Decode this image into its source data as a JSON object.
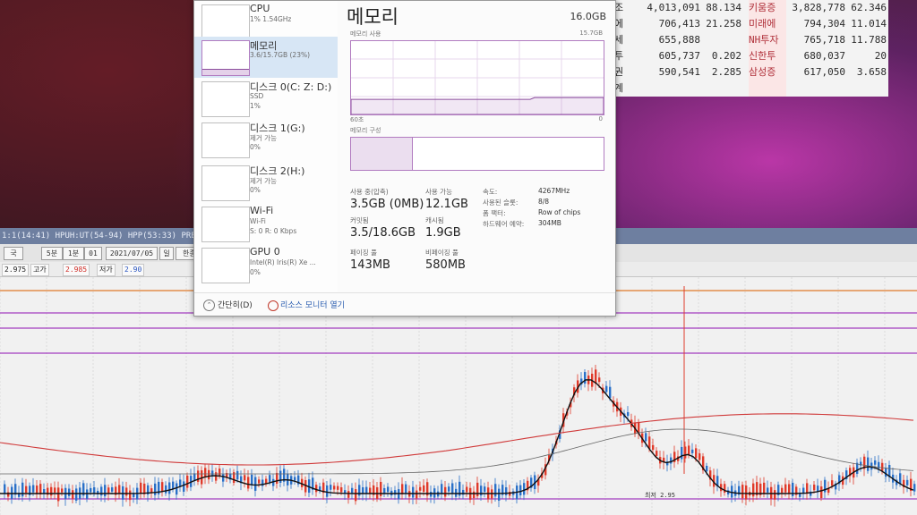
{
  "taskmgr": {
    "sidebar": [
      {
        "title": "CPU",
        "sub": "1% 1.54GHz"
      },
      {
        "title": "메모리",
        "sub": "3.6/15.7GB (23%)"
      },
      {
        "title": "디스크 0(C: Z: D:)",
        "sub": "SSD",
        "sub2": "1%"
      },
      {
        "title": "디스크 1(G:)",
        "sub": "제거 가능",
        "sub2": "0%"
      },
      {
        "title": "디스크 2(H:)",
        "sub": "제거 가능",
        "sub2": "0%"
      },
      {
        "title": "Wi-Fi",
        "sub": "Wi-Fi",
        "sub2": "S: 0 R: 0 Kbps"
      },
      {
        "title": "GPU 0",
        "sub": "Intel(R) Iris(R) Xe ...",
        "sub2": "0%"
      }
    ],
    "main": {
      "title": "메모리",
      "total": "16.0GB",
      "usage_label": "메모리 사용",
      "usage_max": "15.7GB",
      "time_label": "60초",
      "zero_label": "0",
      "composition_label": "메모리 구성",
      "stats": [
        {
          "label": "사용 중(압축)",
          "value": "3.5GB (0MB)"
        },
        {
          "label": "사용 가능",
          "value": "12.1GB"
        },
        {
          "label": "커밋됨",
          "value": "3.5/18.6GB"
        },
        {
          "label": "캐시됨",
          "value": "1.9GB"
        },
        {
          "label": "페이징 풀",
          "value": "143MB"
        },
        {
          "label": "비페이징 풀",
          "value": "580MB"
        }
      ],
      "info": [
        {
          "label": "속도:",
          "value": "4267MHz"
        },
        {
          "label": "사용된 슬롯:",
          "value": "8/8"
        },
        {
          "label": "폼 팩터:",
          "value": "Row of chips"
        },
        {
          "label": "하드웨어 예약:",
          "value": "304MB"
        }
      ],
      "usage_fraction": 0.23
    },
    "footer": {
      "fewer_details": "간단히(D)",
      "open_monitor": "리소스 모니터 열기"
    }
  },
  "stock_table": {
    "rows": [
      {
        "label": "조",
        "v1": "4,013,091",
        "v2": "88.134",
        "name": "키움증",
        "v3": "3,828,778",
        "v4": "62.346"
      },
      {
        "label": "에",
        "v1": "706,413",
        "v2": "21.258",
        "name": "미래에",
        "v3": "794,304",
        "v4": "11.014"
      },
      {
        "label": "세",
        "v1": "655,888",
        "v2": "",
        "name": "NH투자",
        "v3": "765,718",
        "v4": "11.788"
      },
      {
        "label": "투",
        "v1": "605,737",
        "v2": "0.202",
        "name": "신한투",
        "v3": "680,037",
        "v4": "20"
      },
      {
        "label": "권",
        "v1": "590,541",
        "v2": "2.285",
        "name": "삼성증",
        "v3": "617,050",
        "v4": "3.658"
      },
      {
        "label": "계",
        "v1": "",
        "v2": "",
        "name": "",
        "v3": "",
        "v4": ""
      }
    ]
  },
  "chart_window": {
    "title": "1:1(14:41) HPUH:UT(54-94) HPP(53:33) PRE:2 [0] 검신",
    "toolbar": [
      "국",
      "5분",
      "1분",
      "01",
      "2021/07/05",
      "일",
      "한종명"
    ],
    "prices": [
      "2.975",
      "고가",
      "2.985",
      "저가",
      "2.90"
    ],
    "bottom_label": "최저 2.95"
  },
  "colors": {
    "mem_accent": "#b17bc0",
    "selected_bg": "#d7e6f5",
    "candle_up": "#e03a2a",
    "candle_down": "#2a70c8"
  },
  "icons": {
    "fewer_details": "chevron-up-icon",
    "resource_monitor": "monitor-icon"
  }
}
